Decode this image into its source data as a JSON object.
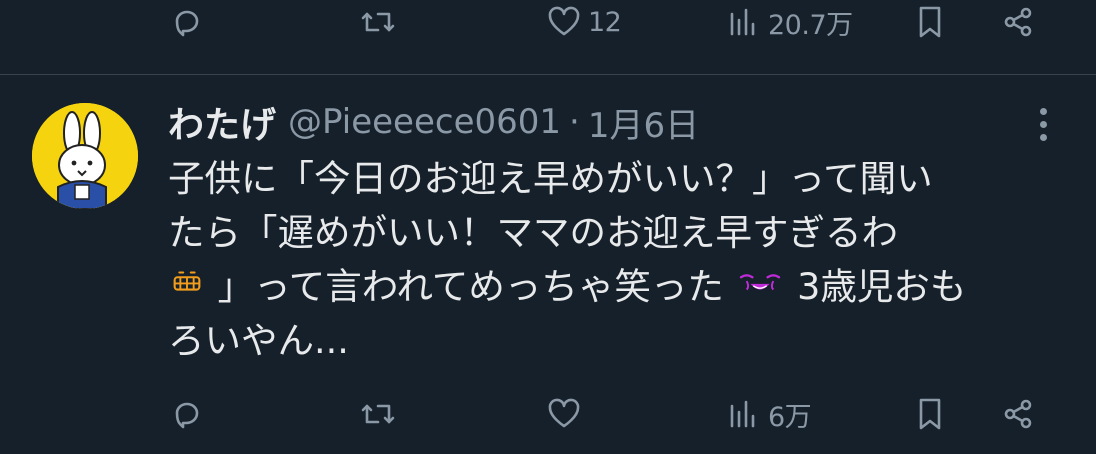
{
  "top_actions": {
    "reply_count": "",
    "retweet_count": "",
    "like_count": "12",
    "views_count": "20.7万"
  },
  "tweet": {
    "author_name": "わたげ",
    "handle": "@Pieeeece0601",
    "separator": "·",
    "date": "1月6日",
    "lines": [
      "子供に「今日のお迎え早めがいい？」って聞い",
      "たら「遅めがいい！ママのお迎え早すぎるわ",
      "」って言われてめっちゃ笑った",
      "3歳児おも",
      "ろいやん..."
    ],
    "emoji": [
      "grimacing-face-emoji",
      "face-holding-back-tears-emoji"
    ]
  },
  "bottom_actions": {
    "reply_count": "",
    "retweet_count": "",
    "like_count": "",
    "views_count": "6万"
  },
  "colors": {
    "background": "#15202b",
    "text": "#e7e9ea",
    "muted": "#8b98a5",
    "divider": "#38444d",
    "avatar_bg": "#f5d40f"
  }
}
